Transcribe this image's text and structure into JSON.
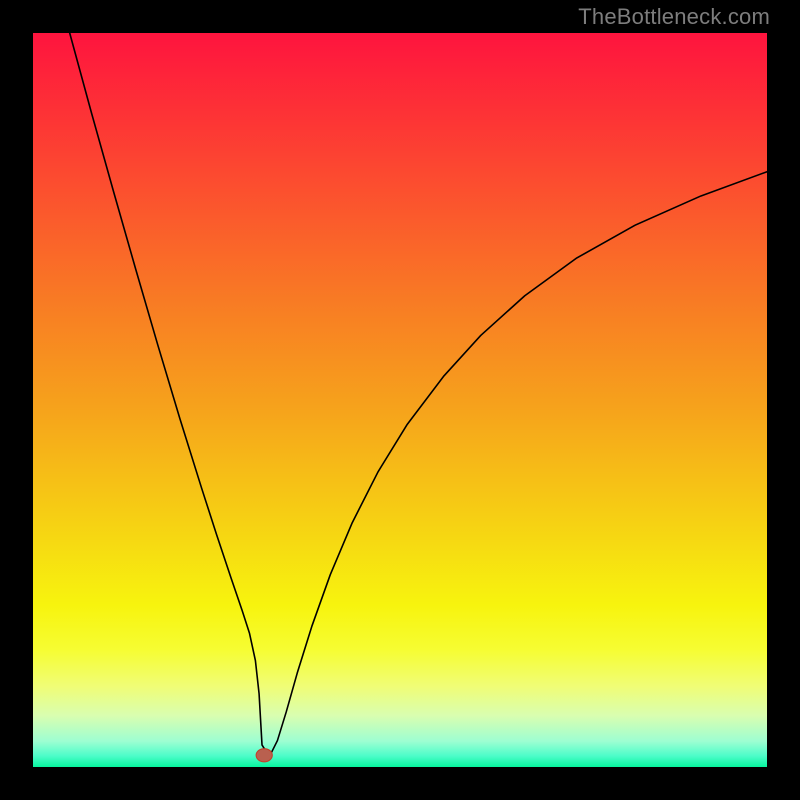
{
  "watermark": "TheBottleneck.com",
  "colors": {
    "frame": "#000000",
    "curve": "#000000",
    "marker_fill": "#b9604f",
    "marker_stroke": "#c2402b",
    "gradient_stops": [
      {
        "offset": 0.0,
        "color": "#fe143e"
      },
      {
        "offset": 0.12,
        "color": "#fd3535"
      },
      {
        "offset": 0.25,
        "color": "#fb5a2c"
      },
      {
        "offset": 0.38,
        "color": "#f87f23"
      },
      {
        "offset": 0.52,
        "color": "#f6a51b"
      },
      {
        "offset": 0.65,
        "color": "#f6cc14"
      },
      {
        "offset": 0.78,
        "color": "#f7f40e"
      },
      {
        "offset": 0.84,
        "color": "#f6fd32"
      },
      {
        "offset": 0.89,
        "color": "#f0fd76"
      },
      {
        "offset": 0.93,
        "color": "#d9feb0"
      },
      {
        "offset": 0.965,
        "color": "#9dfed2"
      },
      {
        "offset": 0.985,
        "color": "#4cfdc9"
      },
      {
        "offset": 1.0,
        "color": "#07f59e"
      }
    ]
  },
  "chart_data": {
    "type": "line",
    "title": "",
    "xlabel": "",
    "ylabel": "",
    "xlim": [
      0,
      100
    ],
    "ylim": [
      0,
      100
    ],
    "grid": false,
    "legend": false,
    "marker": {
      "x": 31.5,
      "y": 1.6,
      "rx": 1.1,
      "ry": 0.9
    },
    "series": [
      {
        "name": "curve",
        "x": [
          5.0,
          8.0,
          11.0,
          14.0,
          17.0,
          20.0,
          23.0,
          25.0,
          27.0,
          28.5,
          29.5,
          30.3,
          30.8,
          31.2,
          31.7,
          32.5,
          33.3,
          34.5,
          36.0,
          38.0,
          40.5,
          43.5,
          47.0,
          51.0,
          56.0,
          61.0,
          67.0,
          74.0,
          82.0,
          91.0,
          100.0
        ],
        "y": [
          100.0,
          89.0,
          78.3,
          67.8,
          57.5,
          47.5,
          37.9,
          31.7,
          25.7,
          21.3,
          18.2,
          14.5,
          10.0,
          3.0,
          2.2,
          2.0,
          3.6,
          7.5,
          12.8,
          19.2,
          26.2,
          33.3,
          40.2,
          46.7,
          53.3,
          58.8,
          64.2,
          69.3,
          73.8,
          77.8,
          81.1
        ]
      }
    ]
  }
}
